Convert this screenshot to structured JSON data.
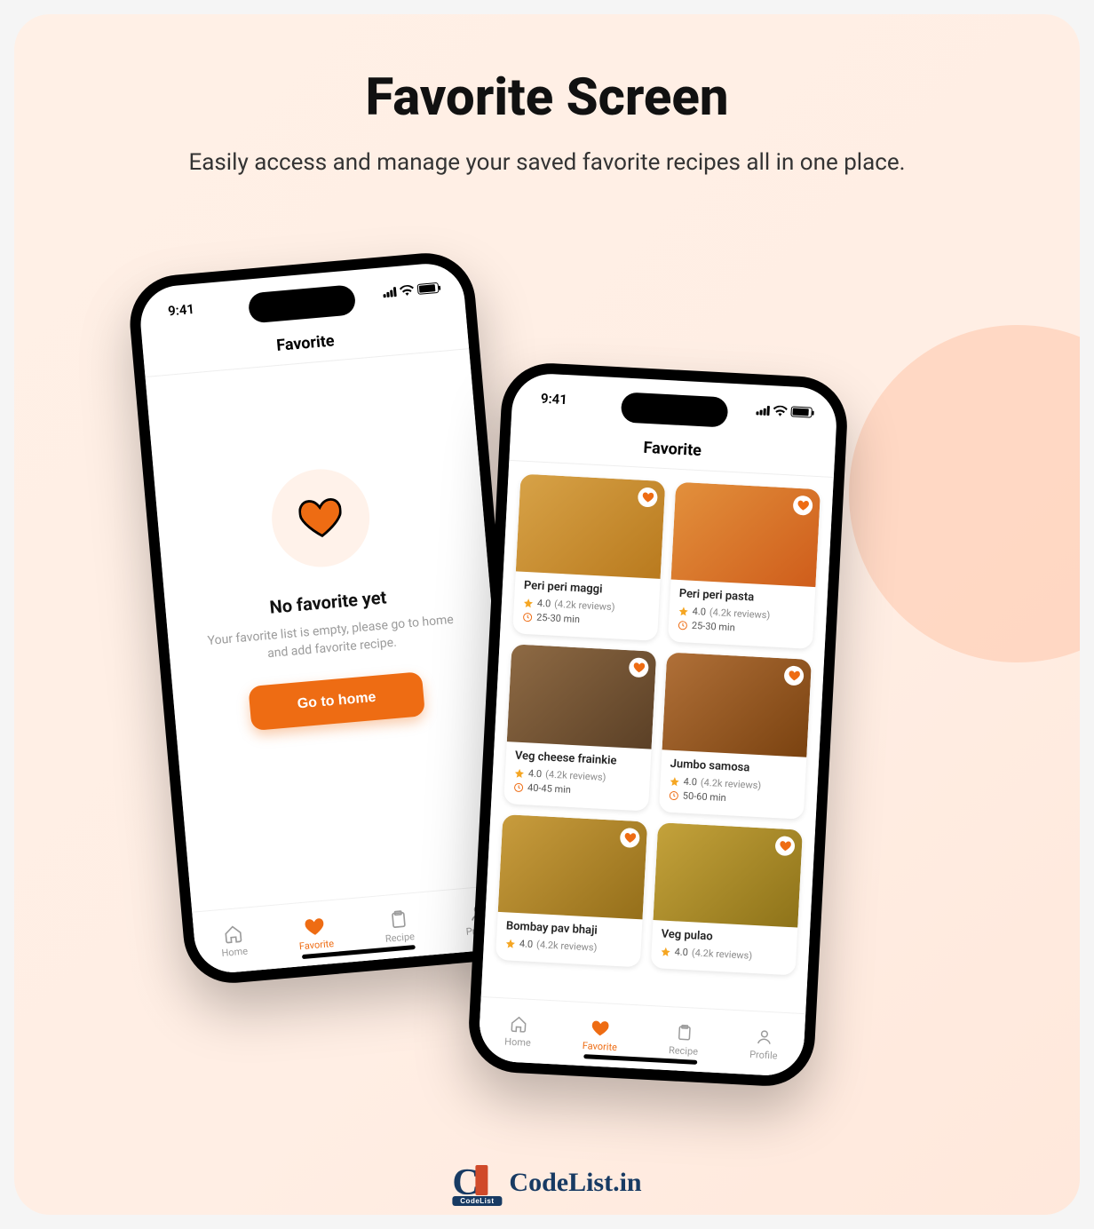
{
  "page": {
    "title": "Favorite Screen",
    "subtitle": "Easily access and manage your saved favorite recipes all in one place."
  },
  "status": {
    "time": "9:41"
  },
  "app_header": {
    "title": "Favorite"
  },
  "empty_state": {
    "title": "No favorite yet",
    "description": "Your favorite list is empty, please go to home and add favorite recipe.",
    "cta_label": "Go to home"
  },
  "nav": {
    "items": [
      {
        "label": "Home"
      },
      {
        "label": "Favorite"
      },
      {
        "label": "Recipe"
      },
      {
        "label": "Profile"
      }
    ],
    "active_index": 1
  },
  "recipes": [
    {
      "title": "Peri peri maggi",
      "rating": "4.0",
      "reviews": "(4.2k reviews)",
      "time": "25-30 min"
    },
    {
      "title": "Peri peri pasta",
      "rating": "4.0",
      "reviews": "(4.2k reviews)",
      "time": "25-30 min"
    },
    {
      "title": "Veg cheese frainkie",
      "rating": "4.0",
      "reviews": "(4.2k reviews)",
      "time": "40-45 min"
    },
    {
      "title": "Jumbo samosa",
      "rating": "4.0",
      "reviews": "(4.2k reviews)",
      "time": "50-60 min"
    },
    {
      "title": "Bombay pav bhaji",
      "rating": "4.0",
      "reviews": "(4.2k reviews)",
      "time": ""
    },
    {
      "title": "Veg pulao",
      "rating": "4.0",
      "reviews": "(4.2k reviews)",
      "time": ""
    }
  ],
  "watermark": {
    "text": "CodeList.in",
    "tag": "CodeList"
  }
}
